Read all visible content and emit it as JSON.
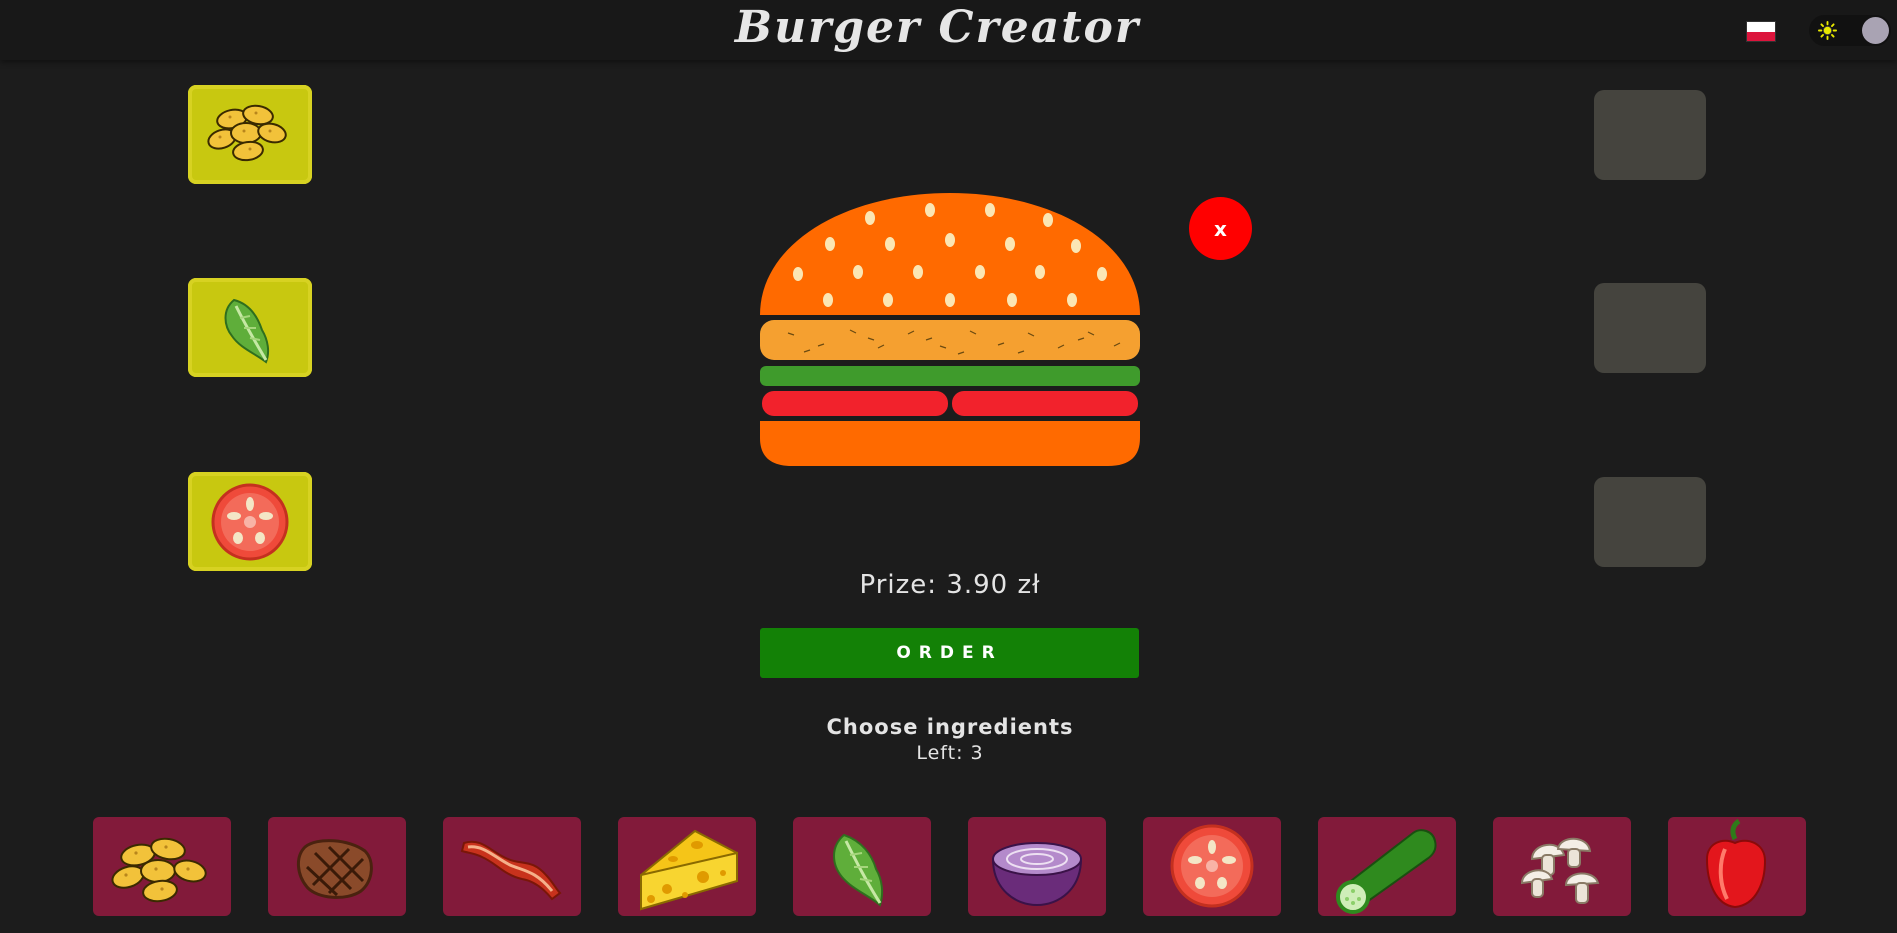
{
  "header": {
    "title": "Burger Creator",
    "language_flag": "flag-pl-icon",
    "theme_toggle": {
      "icon": "sun-icon",
      "state": "dark"
    }
  },
  "selected_ingredients": [
    {
      "name": "nuggets",
      "icon": "nuggets-icon"
    },
    {
      "name": "lettuce",
      "icon": "lettuce-icon"
    },
    {
      "name": "tomato",
      "icon": "tomato-icon"
    }
  ],
  "empty_slots": 3,
  "burger": {
    "layers": [
      "bun-top",
      "nuggets-patty",
      "lettuce",
      "tomato",
      "bun-bottom"
    ]
  },
  "close_button": {
    "label": "x"
  },
  "price": {
    "text": "Prize: 3.90 zł"
  },
  "order_button": {
    "label": "ORDER"
  },
  "chooser": {
    "heading": "Choose ingredients",
    "left_text": "Left: 3"
  },
  "ingredients": [
    {
      "name": "nuggets",
      "icon": "nuggets-icon"
    },
    {
      "name": "steak",
      "icon": "steak-icon"
    },
    {
      "name": "bacon",
      "icon": "bacon-icon"
    },
    {
      "name": "cheese",
      "icon": "cheese-icon"
    },
    {
      "name": "lettuce",
      "icon": "lettuce-icon"
    },
    {
      "name": "onion",
      "icon": "onion-icon"
    },
    {
      "name": "tomato",
      "icon": "tomato-icon"
    },
    {
      "name": "cucumber",
      "icon": "cucumber-icon"
    },
    {
      "name": "mushrooms",
      "icon": "mushrooms-icon"
    },
    {
      "name": "pepper",
      "icon": "pepper-icon"
    }
  ],
  "colors": {
    "background": "#1c1c1c",
    "selected_slot": "#c8c810",
    "empty_slot": "#45443e",
    "ingredient_tile": "#821a3a",
    "order_button": "#138106",
    "close_button": "#ff0000",
    "bun": "#ff6a00"
  }
}
